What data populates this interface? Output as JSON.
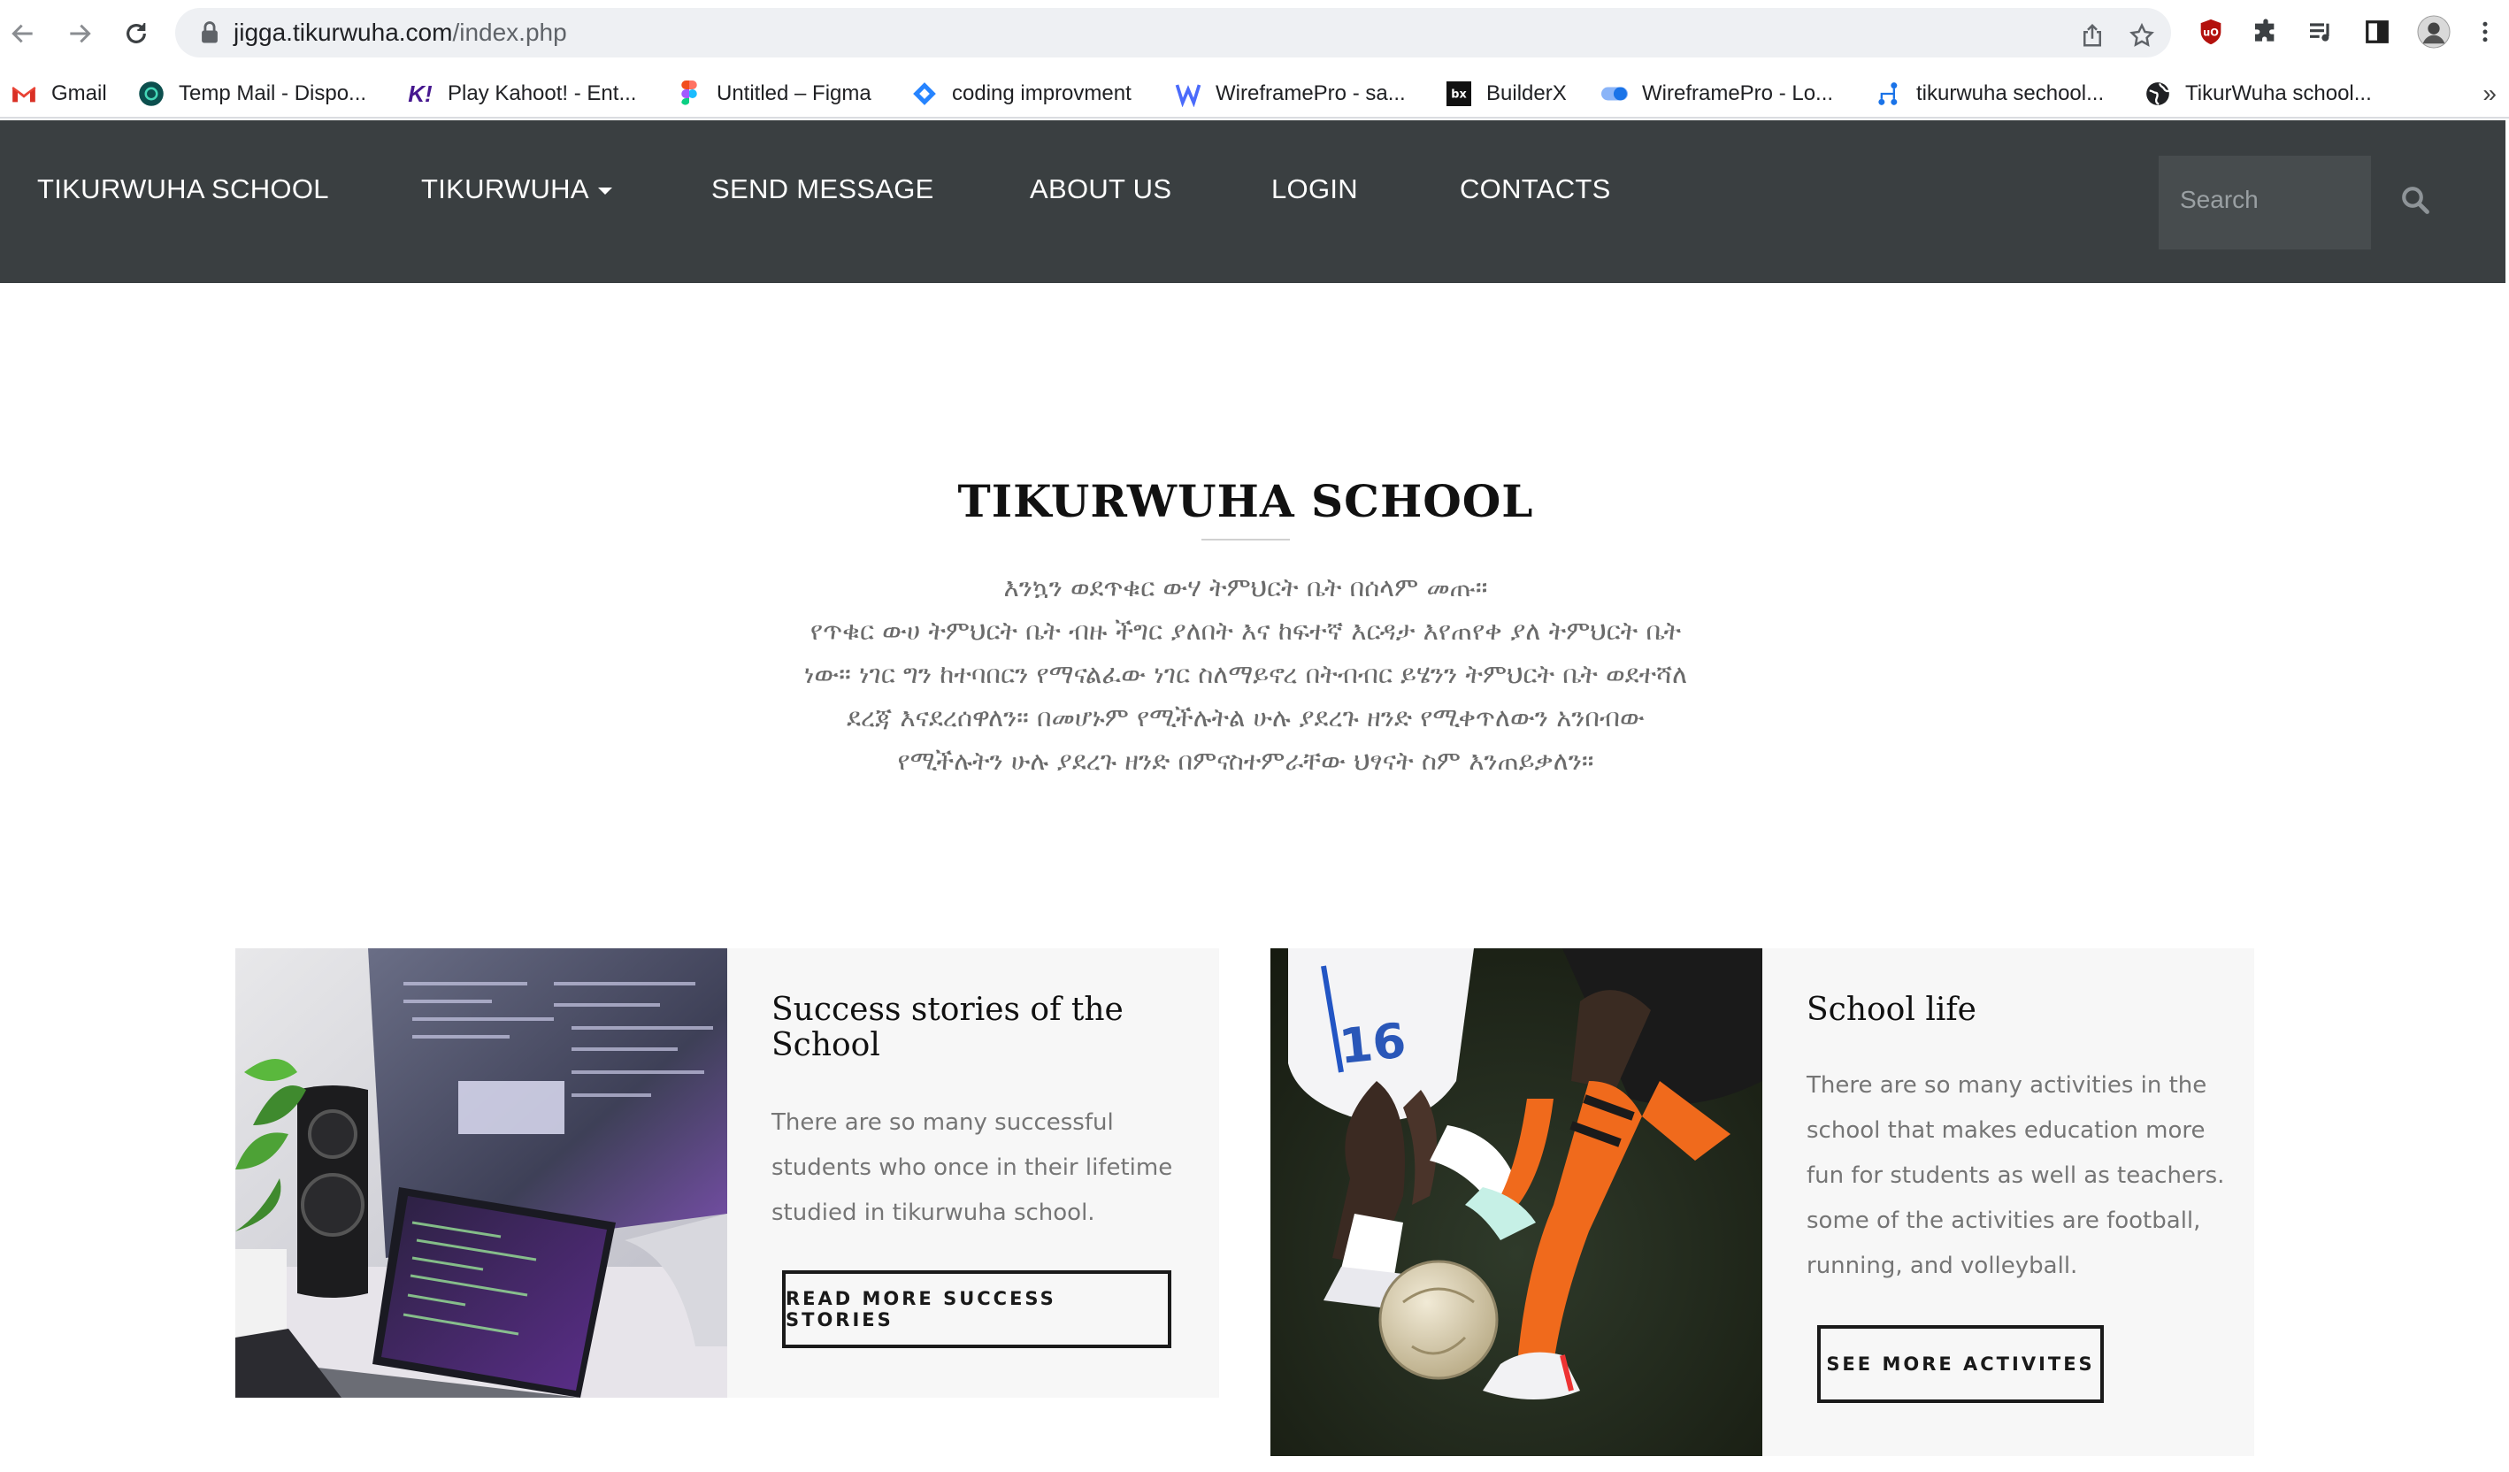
{
  "browser": {
    "url_host": "jigga.tikurwuha.com",
    "url_path": "/index.php",
    "bookmarks": [
      {
        "label": "Gmail",
        "icon": "gmail-icon"
      },
      {
        "label": "Temp Mail - Dispo...",
        "icon": "temp-mail-icon"
      },
      {
        "label": "Play Kahoot! - Ent...",
        "icon": "kahoot-icon"
      },
      {
        "label": "Untitled – Figma",
        "icon": "figma-icon"
      },
      {
        "label": "coding improvment",
        "icon": "jira-icon"
      },
      {
        "label": "WireframePro - sa...",
        "icon": "wireframepro-icon"
      },
      {
        "label": "BuilderX",
        "icon": "builderx-icon"
      },
      {
        "label": "WireframePro - Lo...",
        "icon": "toggle-icon"
      },
      {
        "label": "tikurwuha sechool...",
        "icon": "sitemap-icon"
      },
      {
        "label": "TikurWuha school...",
        "icon": "globe-icon"
      }
    ],
    "more_label": "»"
  },
  "nav": {
    "brand": "TIKURWUHA SCHOOL",
    "dropdown": "TIKURWUHA",
    "send_message": "SEND MESSAGE",
    "about": "ABOUT US",
    "login": "LOGIN",
    "contacts": "CONTACTS",
    "search_placeholder": "Search"
  },
  "hero": {
    "title": "TIKURWUHA SCHOOL",
    "lines": [
      "እንኳን ወደጥቁር ውሃ ትምህርት ቤት በሰላም መጡ።",
      "የጥቁር ውሀ ትምህርት ቤት ብዙ ችግር ያለበት እና ከፍተኛ እርዳታ እየጠየቀ ያለ ትምህርት ቤት",
      "ነው። ነገር ግን ከተባበርን የማናልፈው ነገር ስለማይኖረ በትብብር ይሄንን ትምህርት ቤት ወደተሻለ",
      "ደረጃ እናደረሰዋለን። በመሆኑም የሚችሉትል ሁሉ ያደረጉ ዘንድ የሚቀጥለውን አንበብው",
      "የሚችሉትን ሁሉ ያደረጉ ዘንድ በምናስተምራቸው ህፃናት ስም እንጠይቃለን።"
    ]
  },
  "cards": [
    {
      "title_line1": "Success stories of the",
      "title_line2": "School",
      "text": [
        "There are so many successful",
        "students who once in their lifetime",
        "studied in tikurwuha school."
      ],
      "button": "READ MORE SUCCESS STORIES"
    },
    {
      "title_line1": "School life",
      "text": [
        "There are so many activities in the",
        "school that makes education more",
        "fun for students as well as teachers.",
        "some of the activities are football,",
        "running, and volleyball."
      ],
      "button": "SEE MORE ACTIVITES",
      "jersey_number": "16"
    }
  ]
}
